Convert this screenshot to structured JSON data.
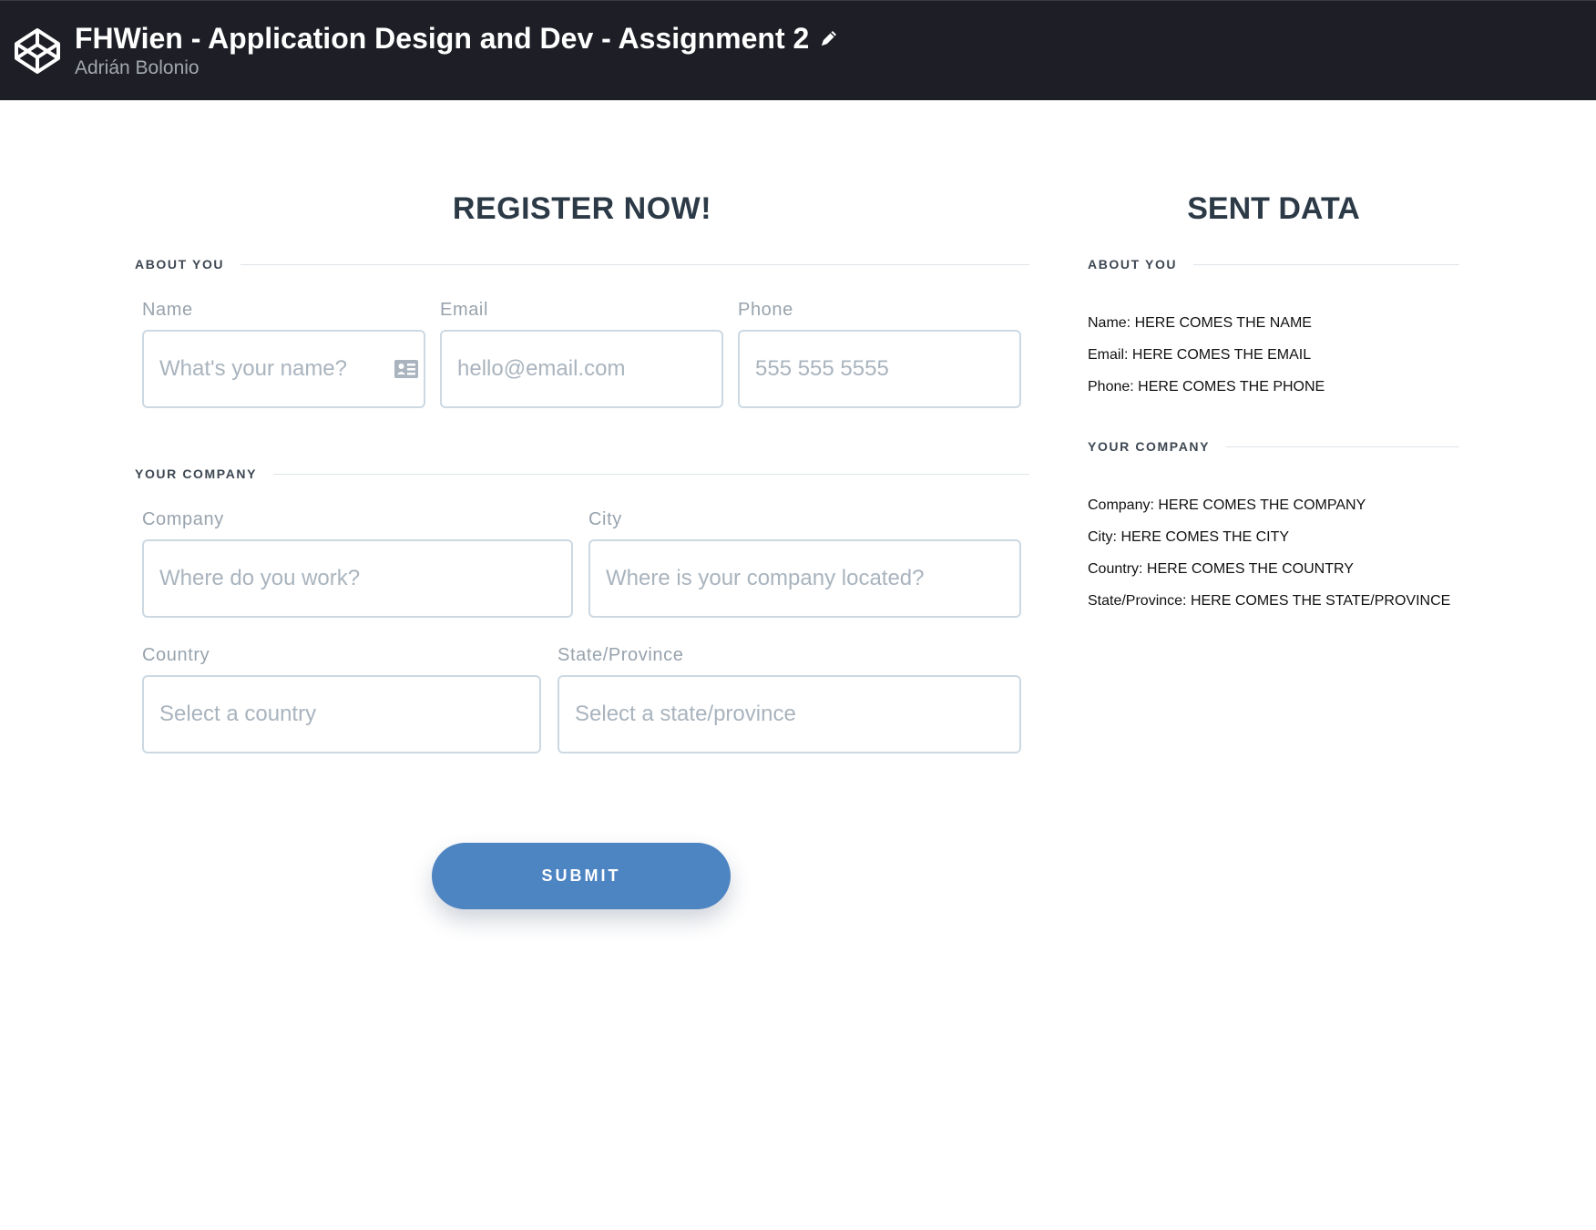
{
  "header": {
    "pen_title": "FHWien - Application Design and Dev - Assignment 2",
    "author": "Adrián Bolonio",
    "logo_icon": "codepen-logo-icon",
    "edit_icon": "pencil-icon"
  },
  "form": {
    "heading": "REGISTER NOW!",
    "about_section": "ABOUT YOU",
    "company_section": "YOUR COMPANY",
    "name": {
      "label": "Name",
      "placeholder": "What's your name?",
      "icon": "contact-card-icon"
    },
    "email": {
      "label": "Email",
      "placeholder": "hello@email.com"
    },
    "phone": {
      "label": "Phone",
      "placeholder": "555 555 5555"
    },
    "company": {
      "label": "Company",
      "placeholder": "Where do you work?"
    },
    "city": {
      "label": "City",
      "placeholder": "Where is your company located?"
    },
    "country": {
      "label": "Country",
      "placeholder": "Select a country"
    },
    "state": {
      "label": "State/Province",
      "placeholder": "Select a state/province"
    },
    "submit_label": "SUBMIT"
  },
  "sent": {
    "heading": "SENT DATA",
    "about_section": "ABOUT YOU",
    "company_section": "YOUR COMPANY",
    "name": "Name: HERE COMES THE NAME",
    "email": "Email: HERE COMES THE EMAIL",
    "phone": "Phone: HERE COMES THE PHONE",
    "company": "Company: HERE COMES THE COMPANY",
    "city": "City: HERE COMES THE CITY",
    "country": "Country: HERE COMES THE COUNTRY",
    "state": "State/Province: HERE COMES THE STATE/PROVINCE"
  },
  "colors": {
    "header_bg": "#1e1f26",
    "accent": "#4d84c2",
    "input_border": "#ccd9e3",
    "heading_text": "#2c3a47"
  }
}
